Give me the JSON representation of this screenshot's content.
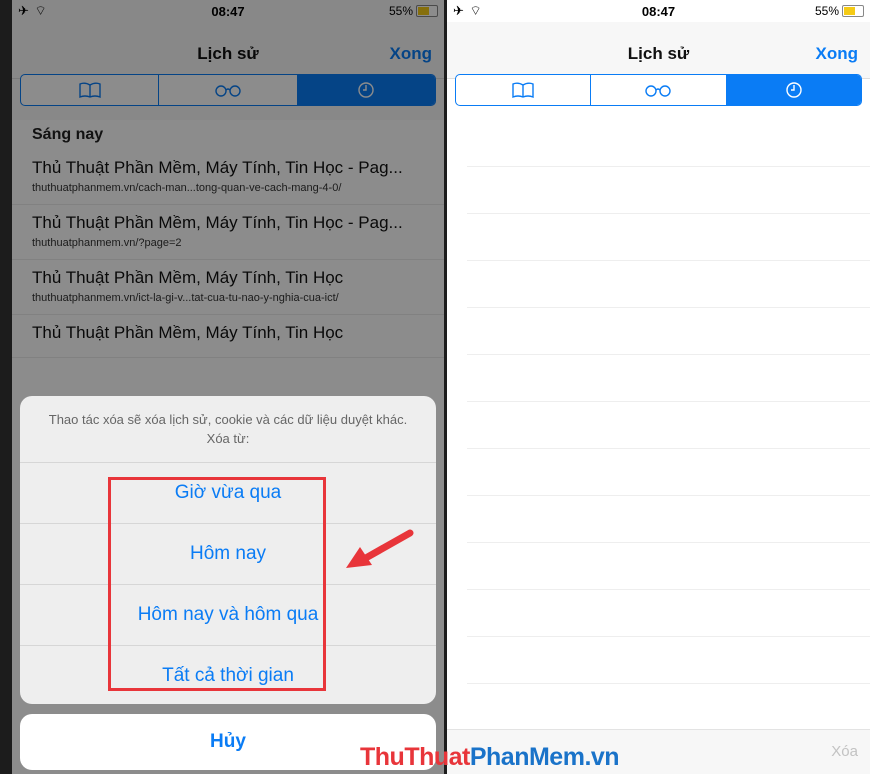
{
  "status": {
    "time": "08:47",
    "battery": "55%"
  },
  "header": {
    "title": "Lịch sử",
    "done": "Xong"
  },
  "segments": [
    {
      "icon": "book-icon"
    },
    {
      "icon": "reading-glasses-icon"
    },
    {
      "icon": "clock-icon",
      "selected": true
    }
  ],
  "history": {
    "section": "Sáng nay",
    "items": [
      {
        "title": "Thủ Thuật Phần Mềm, Máy Tính, Tin Học - Pag...",
        "url": "thuthuatphanmem.vn/cach-man...tong-quan-ve-cach-mang-4-0/"
      },
      {
        "title": "Thủ Thuật Phần Mềm, Máy Tính, Tin Học - Pag...",
        "url": "thuthuatphanmem.vn/?page=2"
      },
      {
        "title": "Thủ Thuật Phần Mềm, Máy Tính, Tin Học",
        "url": "thuthuatphanmem.vn/ict-la-gi-v...tat-cua-tu-nao-y-nghia-cua-ict/"
      },
      {
        "title": "Thủ Thuật Phần Mềm, Máy Tính, Tin Học",
        "url": ""
      }
    ]
  },
  "sheet": {
    "message": "Thao tác xóa sẽ xóa lịch sử, cookie và các dữ liệu duyệt khác. Xóa từ:",
    "options": [
      "Giờ vừa qua",
      "Hôm nay",
      "Hôm nay và hôm qua",
      "Tất cả thời gian"
    ],
    "cancel": "Hủy"
  },
  "right_panel": {
    "clear": "Xóa"
  },
  "watermark": {
    "part1": "ThuThuat",
    "part2": "PhanMem.vn"
  },
  "colors": {
    "accent": "#0a7cf5",
    "highlight": "#e8353a"
  }
}
